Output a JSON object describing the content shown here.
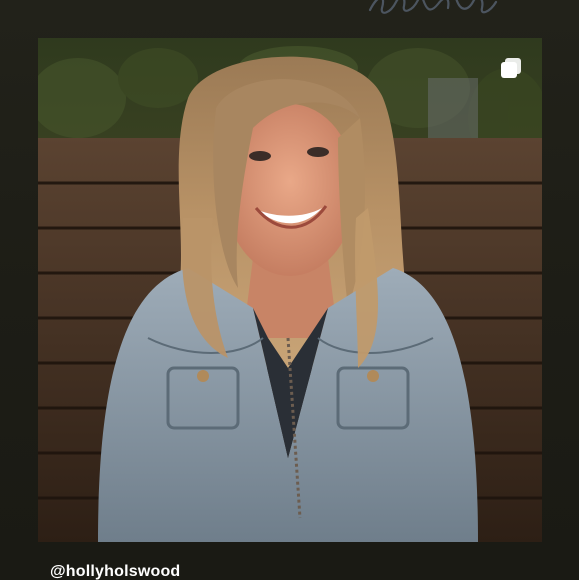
{
  "story": {
    "photo_alt": "",
    "handle": "@hollyholswood",
    "icons": {
      "multi": "carousel-icon",
      "script": "decorative-script-icon"
    },
    "colors": {
      "background": "#1f1f17",
      "handle_text": "#ffffff"
    }
  }
}
